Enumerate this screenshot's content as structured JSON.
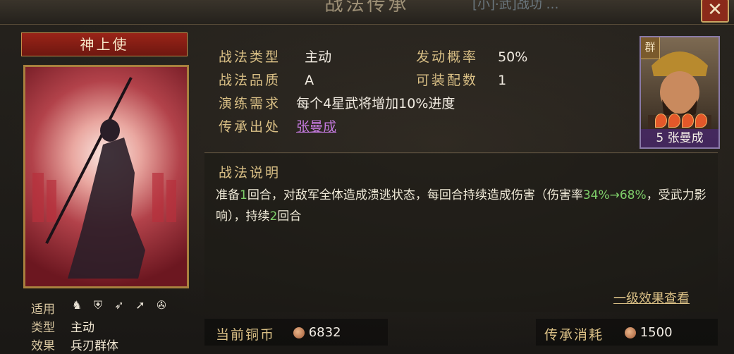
{
  "header": {
    "title": "战法传承",
    "right_text": "[小]·武]战功 …"
  },
  "close_icon": "close-icon",
  "skill": {
    "name": "神上使",
    "meta": [
      {
        "label": "适用",
        "value": ""
      },
      {
        "label": "类型",
        "value": "主动"
      },
      {
        "label": "效果",
        "value": "兵刃群体"
      }
    ],
    "unit_icons": [
      "cavalry-icon",
      "shield-icon",
      "bow-icon",
      "spear-icon",
      "siege-icon"
    ]
  },
  "info": {
    "type_label": "战法类型",
    "type_value": "主动",
    "trigger_label": "发动概率",
    "trigger_value": "50%",
    "quality_label": "战法品质",
    "quality_value": "A",
    "equip_label": "可装配数",
    "equip_value": "1",
    "drill_label": "演练需求",
    "drill_value": "每个4星武将增加10%进度",
    "source_label": "传承出处",
    "source_value": "张曼成"
  },
  "general": {
    "faction": "群",
    "level_name": "5 张曼成",
    "stars": 4
  },
  "description": {
    "title": "战法说明",
    "seg1": "准备",
    "n1": "1",
    "seg2": "回合，对敌军全体造成溃逃状态，每回合持续造成伤害（伤害率",
    "rate": "34%→68%",
    "seg3": "，受武力影响），持续",
    "n2": "2",
    "seg4": "回合"
  },
  "effect_link": "一级效果查看",
  "footer": {
    "copper_label": "当前铜币",
    "copper_value": "6832",
    "cost_label": "传承消耗",
    "cost_value": "1500"
  },
  "colors": {
    "accent": "#d9bf85",
    "highlight": "#7fd06a",
    "link": "#c57adf"
  }
}
